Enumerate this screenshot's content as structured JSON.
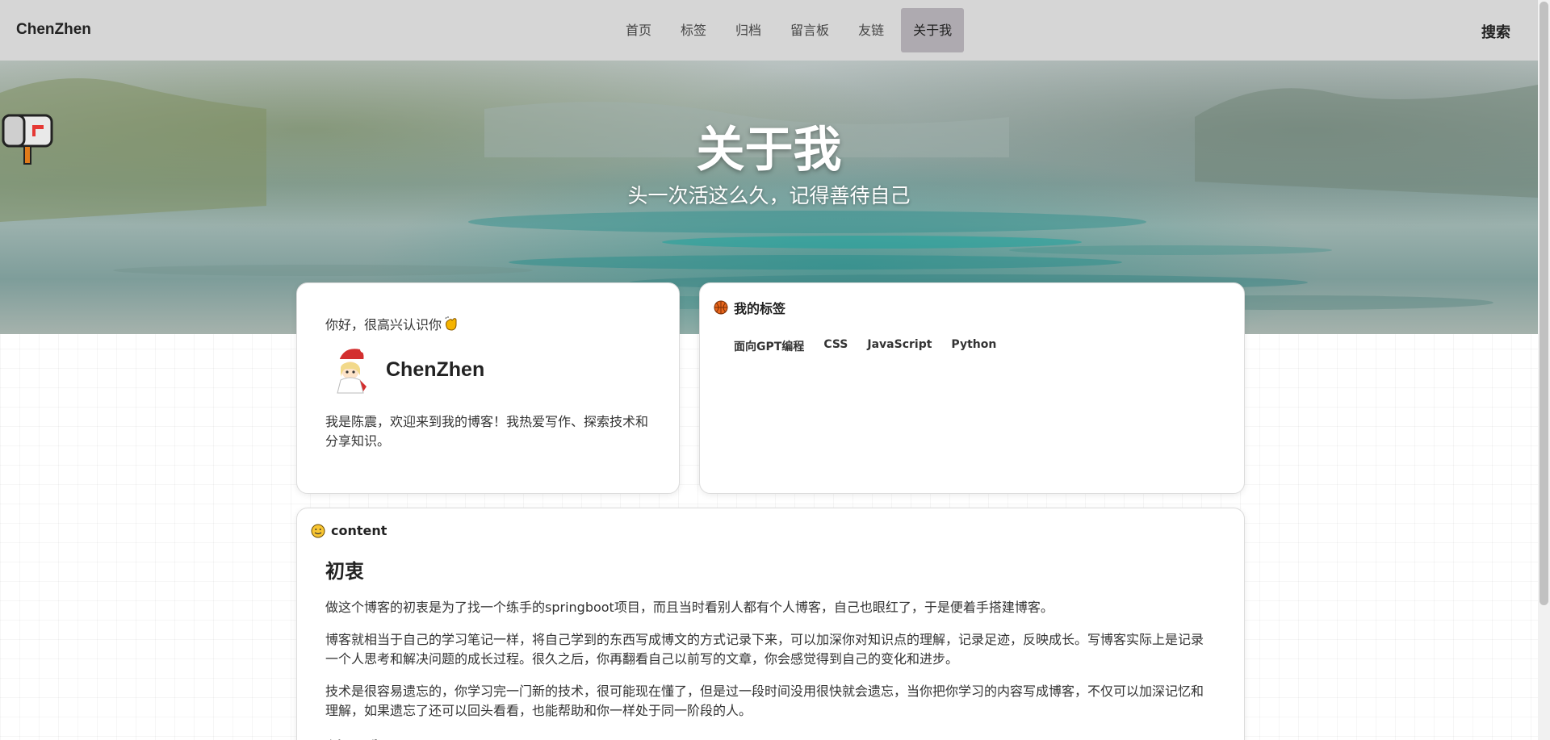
{
  "navbar": {
    "brand": "ChenZhen",
    "items": [
      {
        "label": "首页",
        "active": false
      },
      {
        "label": "标签",
        "active": false
      },
      {
        "label": "归档",
        "active": false
      },
      {
        "label": "留言板",
        "active": false
      },
      {
        "label": "友链",
        "active": false
      },
      {
        "label": "关于我",
        "active": true
      }
    ],
    "search_label": "搜索"
  },
  "hero": {
    "icon": "mailbox-icon",
    "title": "关于我",
    "subtitle": "头一次活这么久，记得善待自己"
  },
  "intro_card": {
    "greeting": "你好，很高兴认识你",
    "greeting_icon": "clapping-hands-icon",
    "name": "ChenZhen",
    "bio": "我是陈震，欢迎来到我的博客！我热爱写作、探索技术和分享知识。"
  },
  "tags_card": {
    "title": "我的标签",
    "icon": "basketball-icon",
    "tags": [
      "面向GPT编程",
      "CSS",
      "JavaScript",
      "Python"
    ]
  },
  "content_card": {
    "title": "content",
    "icon": "smiley-icon",
    "heading": "初衷",
    "paragraphs": [
      "做这个博客的初衷是为了找一个练手的springboot项目，而且当时看别人都有个人博客，自己也眼红了，于是便着手搭建博客。",
      "博客就相当于自己的学习笔记一样，将自己学到的东西写成博文的方式记录下来，可以加深你对知识点的理解，记录足迹，反映成长。写博客实际上是记录一个人思考和解决问题的成长过程。很久之后，你再翻看自己以前写的文章，你会感觉得到自己的变化和进步。",
      "技术是很容易遗忘的，你学习完一门新的技术，很可能现在懂了，但是过一段时间没用很快就会遗忘，当你把你学习的内容写成博客，不仅可以加深记忆和理解，如果遗忘了还可以回头看看，也能帮助和你一样处于同一阶段的人。"
    ],
    "next_heading": "关于我"
  },
  "colors": {
    "navbar_bg": "#d6d6d6",
    "nav_active_bg": "#aeaab0",
    "hero_text": "#ffffff"
  }
}
